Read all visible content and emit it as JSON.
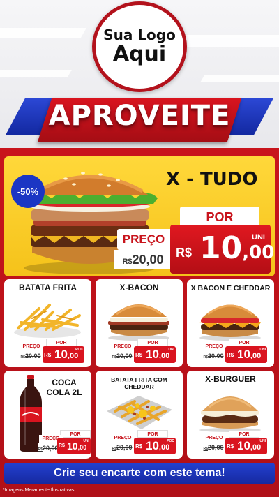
{
  "logo": {
    "line1": "Sua Logo",
    "line2": "Aqui"
  },
  "banner": {
    "text": "APROVEITE"
  },
  "hero": {
    "badge": "-50%",
    "title": "X - TUDO",
    "por_label": "POR",
    "preco_label": "PREÇO",
    "old_currency": "R$",
    "old_price": "20,00",
    "new_currency": "R$",
    "new_price_int": "10",
    "new_price_dec": ",00",
    "unit": "UNI"
  },
  "cards": [
    {
      "title": "BATATA FRITA",
      "preco_label": "PREÇO",
      "por_label": "POR",
      "old_currency": "R$",
      "old_price": "20,00",
      "new_currency": "R$",
      "new_price_int": "10",
      "new_price_dec": ",00",
      "unit": "POC"
    },
    {
      "title": "X-BACON",
      "preco_label": "PREÇO",
      "por_label": "POR",
      "old_currency": "R$",
      "old_price": "20,00",
      "new_currency": "R$",
      "new_price_int": "10",
      "new_price_dec": ",00",
      "unit": "UNI"
    },
    {
      "title": "X BACON E CHEDDAR",
      "preco_label": "PREÇO",
      "por_label": "POR",
      "old_currency": "R$",
      "old_price": "20,00",
      "new_currency": "R$",
      "new_price_int": "10",
      "new_price_dec": ",00",
      "unit": "UNI"
    },
    {
      "title": "COCA COLA 2L",
      "preco_label": "PREÇO",
      "por_label": "POR",
      "old_currency": "R$",
      "old_price": "20,00",
      "new_currency": "R$",
      "new_price_int": "10",
      "new_price_dec": ",00",
      "unit": "UNI"
    },
    {
      "title": "BATATA FRITA COM CHEDDAR",
      "preco_label": "PREÇO",
      "por_label": "POR",
      "old_currency": "R$",
      "old_price": "20,00",
      "new_currency": "R$",
      "new_price_int": "10",
      "new_price_dec": ",00",
      "unit": "POC"
    },
    {
      "title": "X-BURGUER",
      "preco_label": "PREÇO",
      "por_label": "POR",
      "old_currency": "R$",
      "old_price": "20,00",
      "new_currency": "R$",
      "new_price_int": "10",
      "new_price_dec": ",00",
      "unit": "UNI"
    }
  ],
  "cta": {
    "text": "Crie seu encarte com este tema!"
  },
  "footnote": "*Imagens Meramente Ilustrativas",
  "colors": {
    "red": "#c8141c",
    "blue": "#1b36c4",
    "yellow": "#f5c21a"
  }
}
